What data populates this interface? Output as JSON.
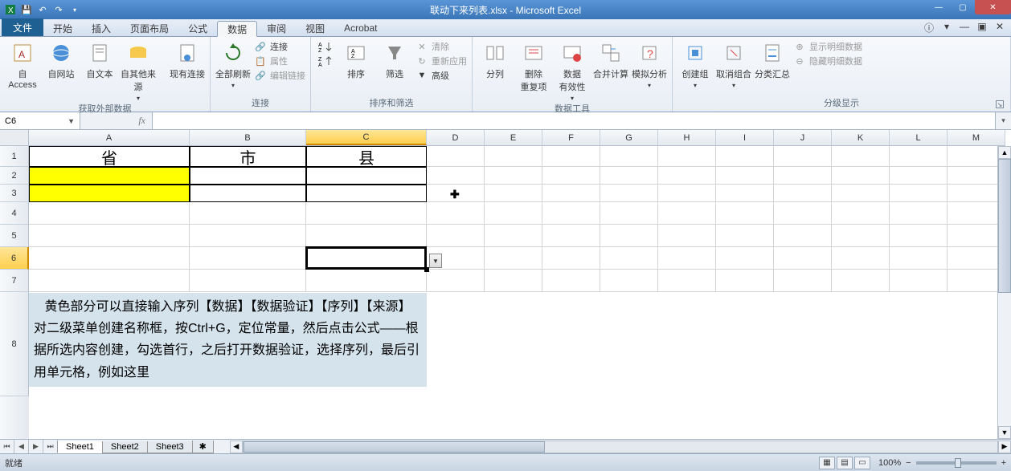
{
  "title": "联动下来列表.xlsx - Microsoft Excel",
  "tabs": {
    "file": "文件",
    "home": "开始",
    "insert": "插入",
    "layout": "页面布局",
    "formulas": "公式",
    "data": "数据",
    "review": "审阅",
    "view": "视图",
    "acrobat": "Acrobat"
  },
  "ribbon": {
    "ext_data": {
      "access": "自 Access",
      "web": "自网站",
      "text": "自文本",
      "other": "自其他来源",
      "existing": "现有连接",
      "label": "获取外部数据"
    },
    "connections": {
      "refresh": "全部刷新",
      "conn": "连接",
      "props": "属性",
      "edit": "编辑链接",
      "label": "连接"
    },
    "sort_filter": {
      "sort": "排序",
      "filter": "筛选",
      "clear": "清除",
      "reapply": "重新应用",
      "advanced": "高级",
      "label": "排序和筛选"
    },
    "data_tools": {
      "ttc": "分列",
      "dup": "删除\n重复项",
      "valid": "数据\n有效性",
      "consolidate": "合并计算",
      "whatif": "模拟分析",
      "label": "数据工具"
    },
    "outline": {
      "group": "创建组",
      "ungroup": "取消组合",
      "subtotal": "分类汇总",
      "showdetail": "显示明细数据",
      "hidedetail": "隐藏明细数据",
      "label": "分级显示"
    }
  },
  "namebox": "C6",
  "columns": [
    "A",
    "B",
    "C",
    "D",
    "E",
    "F",
    "G",
    "H",
    "I",
    "J",
    "K",
    "L",
    "M"
  ],
  "col_widths": {
    "A": 200,
    "B": 145,
    "C": 150,
    "other": 72
  },
  "rows": [
    1,
    2,
    3,
    4,
    5,
    6,
    7,
    8
  ],
  "row_heights": {
    "1": 26,
    "2": 22,
    "3": 22,
    "4": 28,
    "5": 28,
    "6": 28,
    "7": 28,
    "8": 130
  },
  "headers": {
    "A1": "省",
    "B1": "市",
    "C1": "县"
  },
  "note_line1": "黄色部分可以直接输入序列【数据】【数据验证】【序列】【来源】",
  "note_line2": "对二级菜单创建名称框，按Ctrl+G，定位常量，然后点击公式——根据所选内容创建，勾选首行，之后打开数据验证，选择序列，最后引用单元格，例如这里",
  "sheets": [
    "Sheet1",
    "Sheet2",
    "Sheet3"
  ],
  "status": "就绪",
  "zoom": "100%"
}
